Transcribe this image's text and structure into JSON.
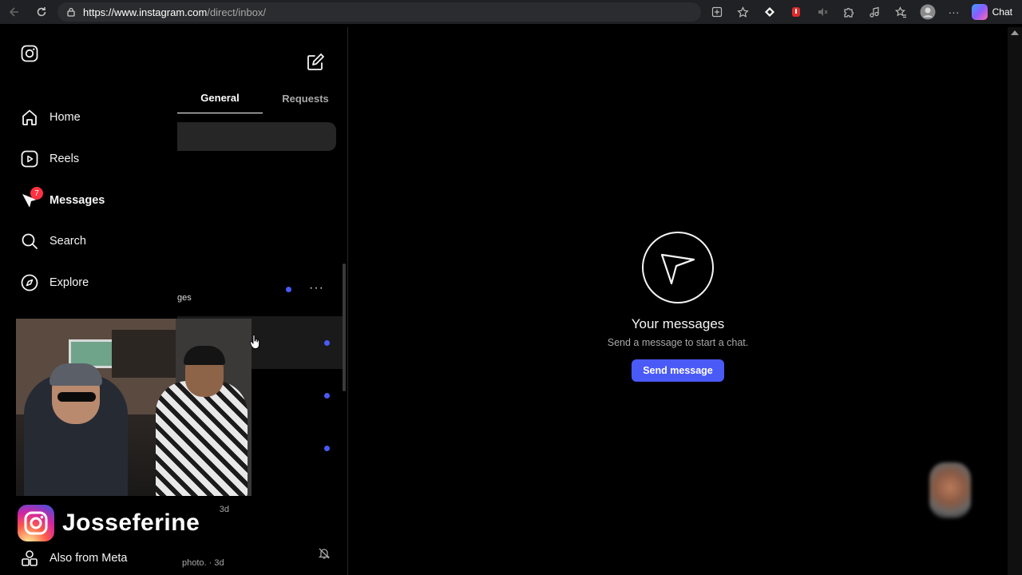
{
  "browser": {
    "url_host": "https://www.instagram.com",
    "url_path": "/direct/inbox/",
    "chat_label": "Chat",
    "icons": [
      "back-arrow-icon",
      "refresh-icon",
      "lock-icon",
      "app-available-icon",
      "favorite-star-icon",
      "extension-icon",
      "extension-icon",
      "mute-icon",
      "extensions-puzzle-icon",
      "music-icon",
      "favorites-icon",
      "profile-icon",
      "more-icon"
    ]
  },
  "sidebar": {
    "items": [
      {
        "label": "Home",
        "icon": "home-icon"
      },
      {
        "label": "Reels",
        "icon": "reels-icon"
      },
      {
        "label": "Messages",
        "icon": "messages-icon",
        "badge": "7"
      },
      {
        "label": "Search",
        "icon": "search-icon"
      },
      {
        "label": "Explore",
        "icon": "explore-icon"
      }
    ],
    "bottom_item": {
      "label": "Also from Meta",
      "icon": "meta-apps-icon"
    }
  },
  "inbox": {
    "tabs": [
      {
        "label": "General",
        "active": true
      },
      {
        "label": "Requests",
        "active": false
      }
    ],
    "snippets": [
      "ges",
      "· 3d",
      "photo. · 3d"
    ]
  },
  "empty_state": {
    "title": "Your messages",
    "subtitle": "Send a message to start a chat.",
    "button": "Send message"
  },
  "overlay": {
    "streamer_name": "Josseferine"
  },
  "colors": {
    "accent": "#4a5af7",
    "badge": "#ff3040",
    "background": "#000000"
  }
}
